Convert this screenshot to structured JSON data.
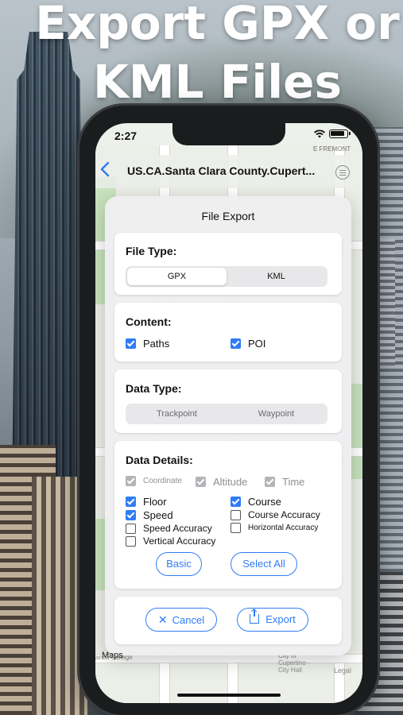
{
  "headline": {
    "line1": "Export GPX or",
    "line2": "KML Files"
  },
  "status_bar": {
    "time": "2:27"
  },
  "nav": {
    "title": "US.CA.Santa Clara County.Cupert..."
  },
  "map": {
    "labels": [
      "E FREMONT",
      "Legal",
      "Maps",
      "anza College",
      "City of",
      "Cupertino - ",
      "City Hall"
    ]
  },
  "dialog": {
    "title": "File Export",
    "file_type": {
      "heading": "File Type:",
      "options": [
        "GPX",
        "KML"
      ],
      "selected": "GPX"
    },
    "content": {
      "heading": "Content:",
      "items": [
        {
          "label": "Paths",
          "checked": true
        },
        {
          "label": "POI",
          "checked": true
        }
      ]
    },
    "data_type": {
      "heading": "Data Type:",
      "options": [
        "Trackpoint",
        "Waypoint"
      ]
    },
    "data_details": {
      "heading": "Data Details:",
      "fixed": [
        "Coordinate",
        "Altitude",
        "Time"
      ],
      "items": [
        {
          "label": "Floor",
          "checked": true
        },
        {
          "label": "Course",
          "checked": true
        },
        {
          "label": "Speed",
          "checked": true
        },
        {
          "label": "Course Accuracy",
          "checked": false
        },
        {
          "label": "Speed Accuracy",
          "checked": false
        },
        {
          "label": "Horizontal Accuracy",
          "checked": false
        },
        {
          "label": "Vertical Accuracy",
          "checked": false
        }
      ],
      "basic_label": "Basic",
      "select_all_label": "Select All"
    },
    "actions": {
      "cancel_label": "Cancel",
      "export_label": "Export"
    }
  },
  "colors": {
    "accent": "#2f7cf6",
    "checkbox_disabled": "#b3b4b8"
  },
  "icons": [
    "chevron-left-icon",
    "list-icon",
    "wifi-icon",
    "battery-icon",
    "close-icon",
    "share-icon"
  ]
}
